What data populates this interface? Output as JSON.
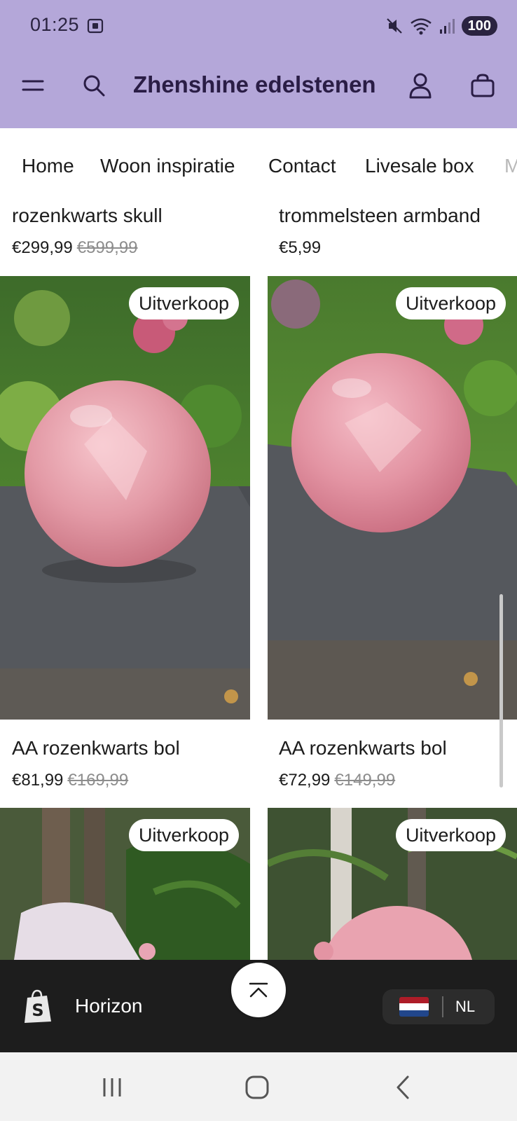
{
  "status_bar": {
    "time": "01:25",
    "battery": "100",
    "icons": [
      "screenshot-icon",
      "mute-icon",
      "wifi-icon",
      "signal-icon"
    ]
  },
  "header": {
    "title": "Zhenshine edelstenen",
    "background": "#b4a7d9",
    "icons": [
      "menu-icon",
      "search-icon",
      "account-icon",
      "cart-icon"
    ]
  },
  "nav": {
    "items": [
      "Home",
      "Woon inspiratie",
      "Contact",
      "Livesale box"
    ],
    "overflow_hint": "M"
  },
  "products": {
    "row1": [
      {
        "name": "rozenkwarts skull",
        "price": "€299,99",
        "old_price": "€599,99"
      },
      {
        "name": "trommelsteen armband",
        "price": "€5,99",
        "old_price": ""
      }
    ],
    "row2": [
      {
        "name": "AA rozenkwarts bol",
        "price": "€81,99",
        "old_price": "€169,99",
        "badge": "Uitverkoop"
      },
      {
        "name": "AA rozenkwarts bol",
        "price": "€72,99",
        "old_price": "€149,99",
        "badge": "Uitverkoop"
      }
    ],
    "row3": [
      {
        "badge": "Uitverkoop"
      },
      {
        "badge": "Uitverkoop"
      }
    ]
  },
  "shop_bar": {
    "name": "Horizon",
    "language": "NL",
    "flag_colors": [
      "#ae1c28",
      "#ffffff",
      "#21468b"
    ]
  }
}
